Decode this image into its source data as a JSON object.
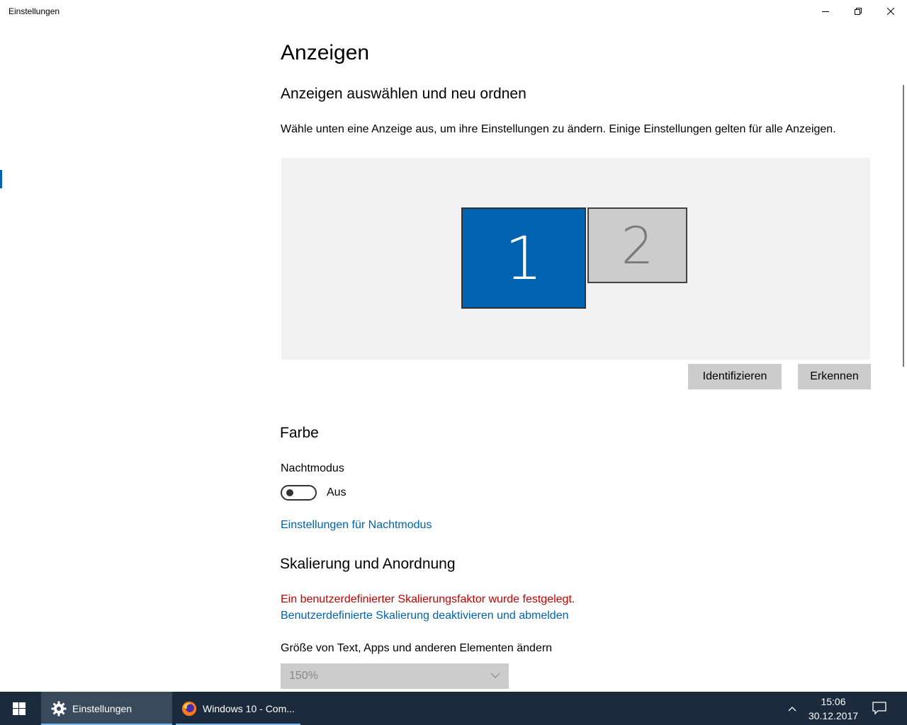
{
  "window": {
    "title": "Einstellungen"
  },
  "page": {
    "title": "Anzeigen",
    "arrange_heading": "Anzeigen auswählen und neu ordnen",
    "arrange_desc": "Wähle unten eine Anzeige aus, um ihre Einstellungen zu ändern. Einige Einstellungen gelten für alle Anzeigen.",
    "monitors": [
      "1",
      "2"
    ],
    "identify_label": "Identifizieren",
    "detect_label": "Erkennen",
    "color_heading": "Farbe",
    "night_mode_label": "Nachtmodus",
    "night_mode_state": "Aus",
    "night_mode_link": "Einstellungen für Nachtmodus",
    "scaling_heading": "Skalierung und Anordnung",
    "scaling_warning": "Ein benutzerdefinierter Skalierungsfaktor wurde festgelegt.",
    "scaling_link": "Benutzerdefinierte Skalierung deaktivieren und abmelden",
    "size_label": "Größe von Text, Apps und anderen Elementen ändern",
    "size_value": "150%"
  },
  "taskbar": {
    "items": [
      {
        "label": "Einstellungen",
        "icon": "gear-icon"
      },
      {
        "label": "Windows 10 - Com...",
        "icon": "firefox-icon"
      }
    ],
    "time": "15:06",
    "date": "30.12.2017"
  },
  "colors": {
    "accent": "#0063b1",
    "warning": "#c50000",
    "taskbar": "#1b2a3d"
  }
}
